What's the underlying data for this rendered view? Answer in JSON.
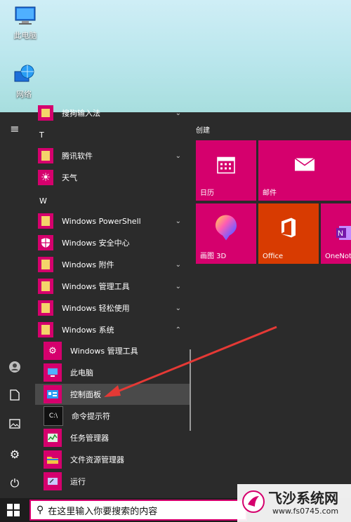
{
  "desktop": {
    "icons": [
      {
        "label": "此电脑",
        "icon": "computer-icon"
      },
      {
        "label": "网络",
        "icon": "network-globe-icon"
      }
    ]
  },
  "applist": {
    "partial_top": "搜狗输入法",
    "letters": [
      "T",
      "W"
    ],
    "items": [
      {
        "label": "腾讯软件",
        "icon": "folder-icon"
      },
      {
        "label": "天气",
        "icon": "weather-sun-icon"
      },
      {
        "label": "Windows PowerShell",
        "icon": "folder-icon"
      },
      {
        "label": "Windows 安全中心",
        "icon": "shield-icon"
      },
      {
        "label": "Windows 附件",
        "icon": "folder-icon"
      },
      {
        "label": "Windows 管理工具",
        "icon": "folder-icon"
      },
      {
        "label": "Windows 轻松使用",
        "icon": "folder-icon"
      },
      {
        "label": "Windows 系统",
        "icon": "folder-open-icon"
      }
    ],
    "sub_items": [
      {
        "label": "Windows 管理工具",
        "icon": "admin-tools-icon"
      },
      {
        "label": "此电脑",
        "icon": "computer-icon"
      },
      {
        "label": "控制面板",
        "icon": "control-panel-icon"
      },
      {
        "label": "命令提示符",
        "icon": "cmd-icon"
      },
      {
        "label": "任务管理器",
        "icon": "task-manager-icon"
      },
      {
        "label": "文件资源管理器",
        "icon": "file-explorer-icon"
      },
      {
        "label": "运行",
        "icon": "run-icon"
      }
    ]
  },
  "tiles": {
    "group_title": "创建",
    "items": [
      {
        "label": "日历",
        "icon": "calendar-icon",
        "color": "#d5006d"
      },
      {
        "label": "邮件",
        "icon": "mail-icon",
        "color": "#d5006d"
      },
      {
        "label": "画图 3D",
        "icon": "paint3d-icon",
        "color": "#d5006d"
      },
      {
        "label": "Office",
        "icon": "office-icon",
        "color": "#d83b01"
      },
      {
        "label": "OneNot",
        "icon": "onenote-icon",
        "color": "#d5006d"
      }
    ]
  },
  "taskbar": {
    "search_placeholder": "在这里输入你要搜索的内容"
  },
  "watermark": {
    "title": "飞沙系统网",
    "url": "www.fs0745.com"
  },
  "colors": {
    "accent": "#d5006d",
    "menu_bg": "#2b2b2b",
    "office_orange": "#d83b01",
    "annotation_arrow": "#e53935"
  }
}
